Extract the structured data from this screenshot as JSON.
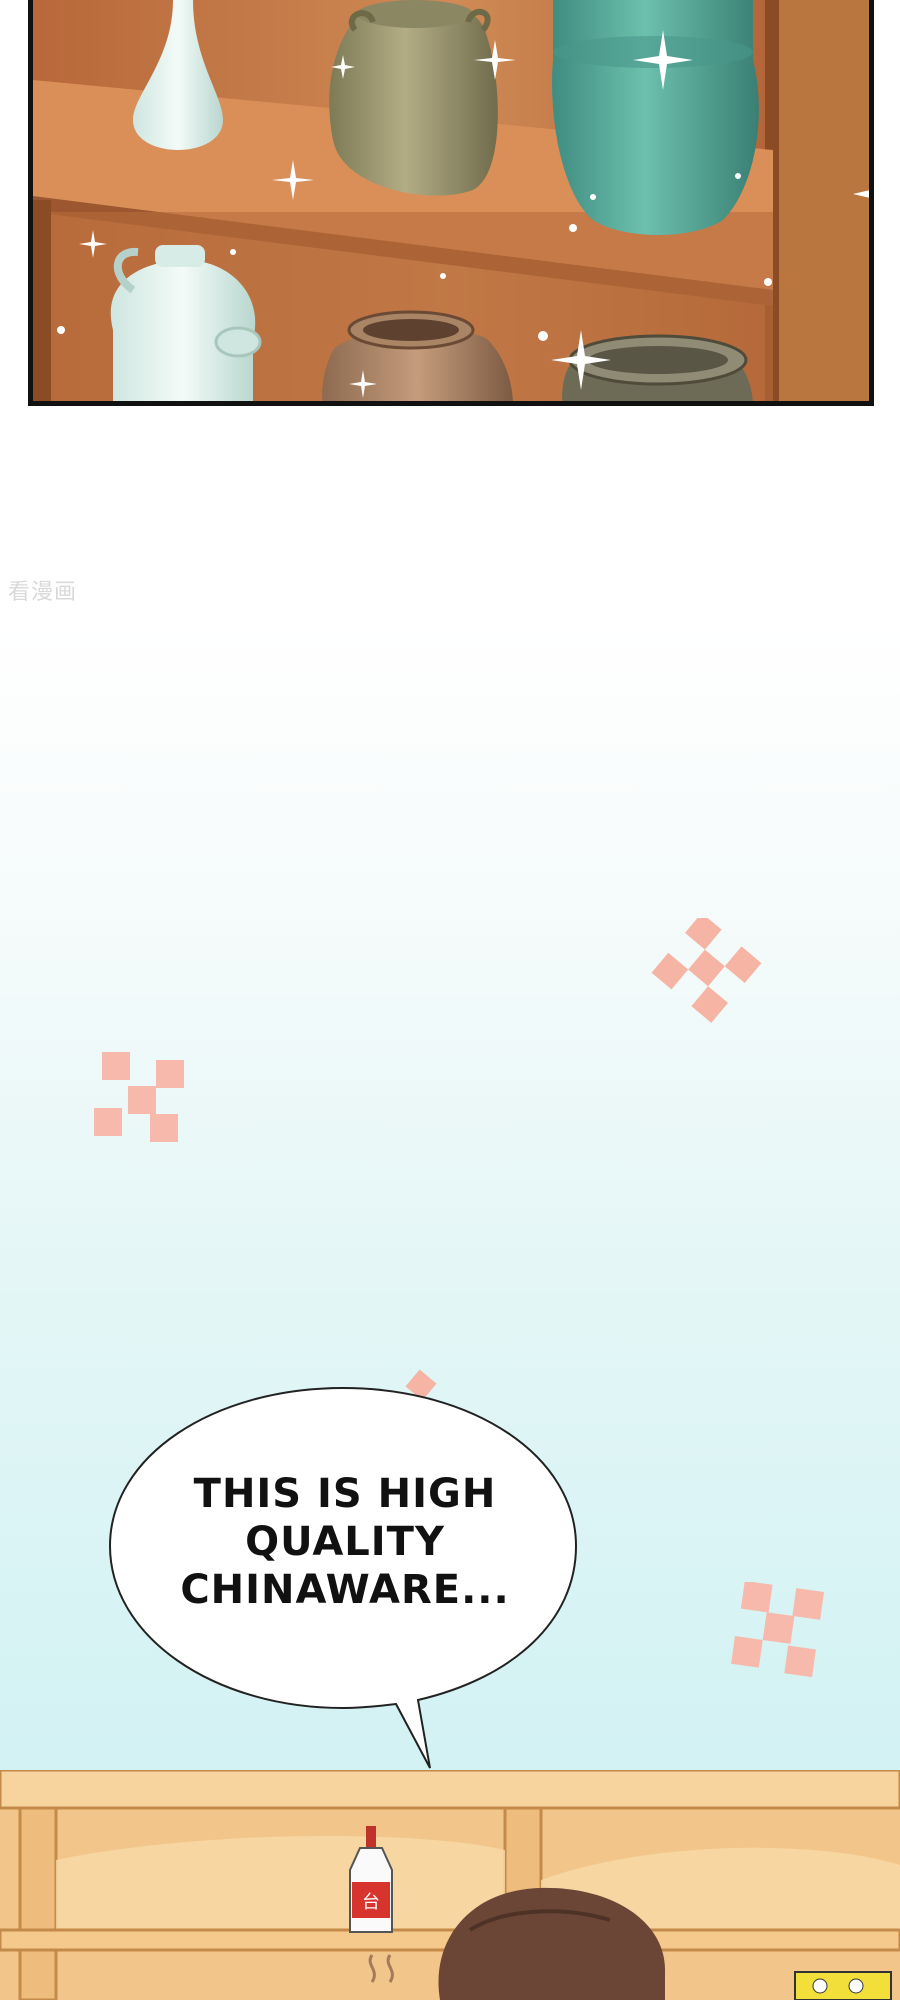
{
  "watermark": "看漫画",
  "speech_bubble": {
    "text": "THIS IS HIGH QUALITY CHINAWARE..."
  },
  "bottle_label": "台",
  "colors": {
    "shelf_brown": "#c77b45",
    "celadon_vase": "#5fae9e",
    "olive_jar": "#a9a37a",
    "checker_pink": "#f5b4a4",
    "sky_teal": "#d0f0f2",
    "bottom_shelf": "#f2c68a"
  },
  "icons": [
    "sparkle-icon",
    "checker-pattern-icon"
  ]
}
